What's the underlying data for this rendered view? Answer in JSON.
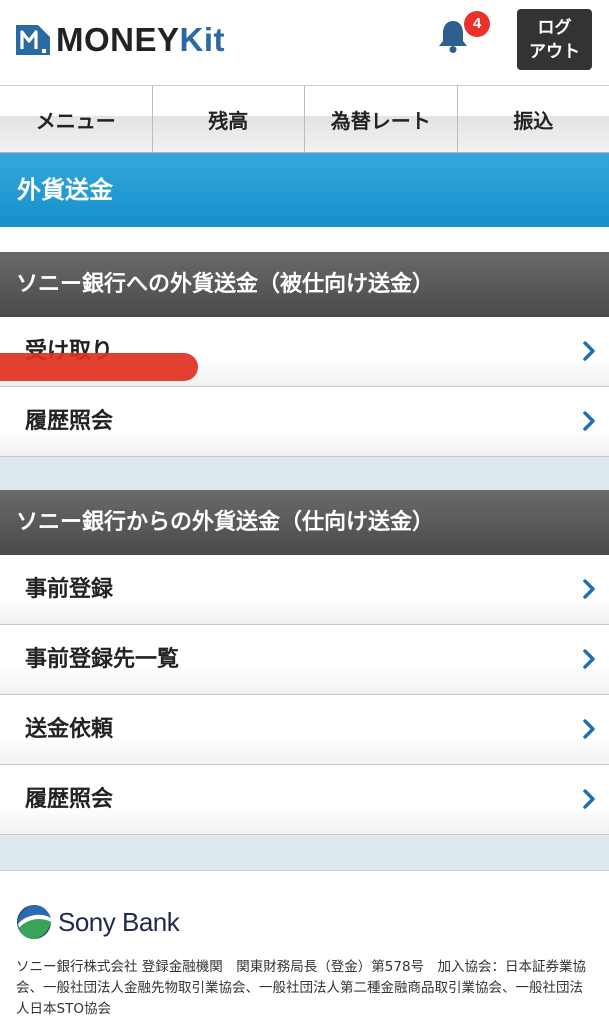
{
  "header": {
    "logo_money": "MONEY",
    "logo_kit": "Kit",
    "notification_count": "4",
    "logout_line1": "ログ",
    "logout_line2": "アウト"
  },
  "tabs": [
    {
      "label": "メニュー"
    },
    {
      "label": "残高"
    },
    {
      "label": "為替レート"
    },
    {
      "label": "振込"
    }
  ],
  "page": {
    "title": "外貨送金"
  },
  "sections": [
    {
      "title": "ソニー銀行への外貨送金（被仕向け送金）",
      "items": [
        {
          "label": "受け取り"
        },
        {
          "label": "履歴照会"
        }
      ]
    },
    {
      "title": "ソニー銀行からの外貨送金（仕向け送金）",
      "items": [
        {
          "label": "事前登録"
        },
        {
          "label": "事前登録先一覧"
        },
        {
          "label": "送金依頼"
        },
        {
          "label": "履歴照会"
        }
      ]
    }
  ],
  "footer": {
    "brand": "Sony Bank",
    "legal": "ソニー銀行株式会社 登録金融機関　関東財務局長（登金）第578号　加入協会：日本証券業協会、一般社団法人金融先物取引業協会、一般社団法人第二種金融商品取引業協会、一般社団法人日本STO協会"
  },
  "colors": {
    "accent_blue": "#1590ca",
    "section_gray": "#4a4a4a",
    "badge_red": "#e8322b",
    "chevron_blue": "#1f6fb0"
  },
  "icons": {
    "notification": "bell-icon",
    "row_arrow": "chevron-right-icon"
  }
}
